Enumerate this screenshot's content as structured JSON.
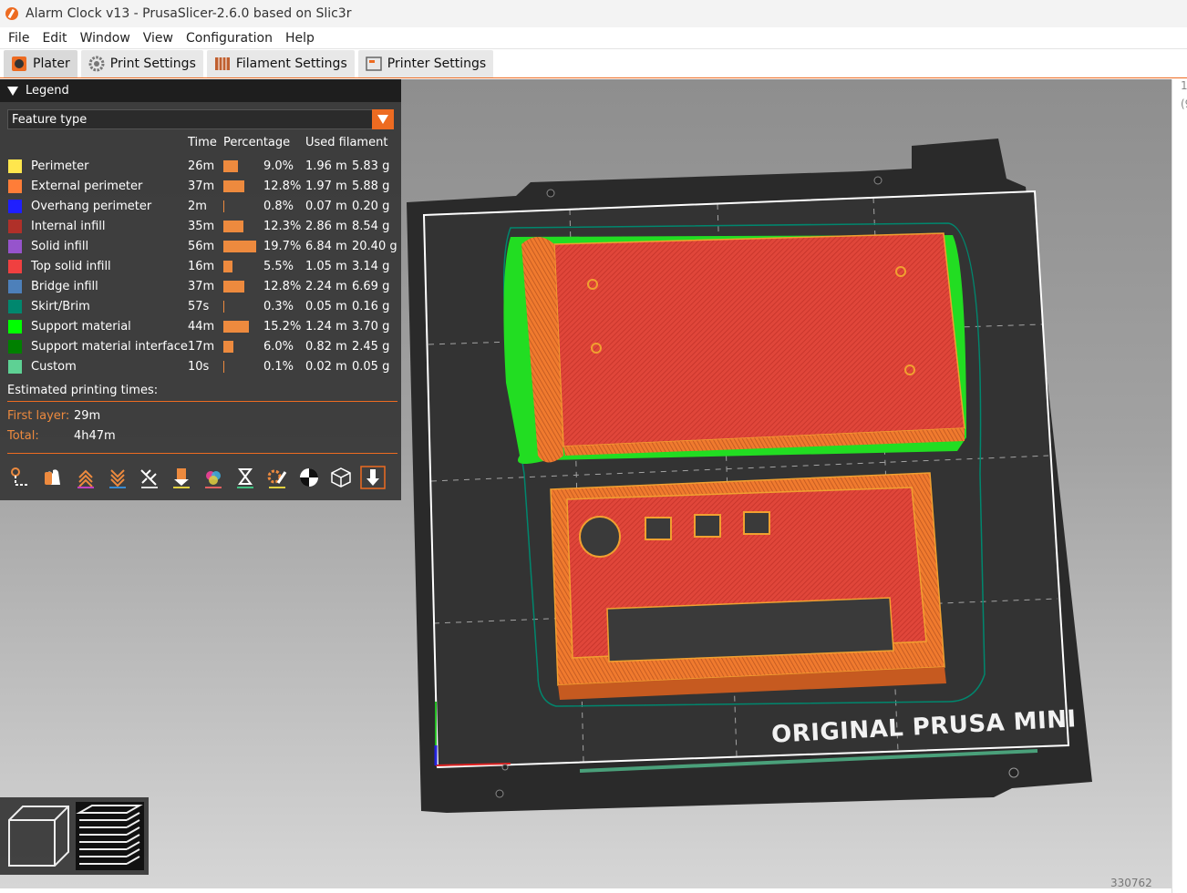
{
  "window": {
    "title": "Alarm Clock v13 - PrusaSlicer-2.6.0 based on Slic3r"
  },
  "menu": [
    "File",
    "Edit",
    "Window",
    "View",
    "Configuration",
    "Help"
  ],
  "tabs": [
    {
      "label": "Plater",
      "icon": "plater-icon",
      "active": true
    },
    {
      "label": "Print Settings",
      "icon": "gear-icon",
      "active": false
    },
    {
      "label": "Filament Settings",
      "icon": "filament-spool-icon",
      "active": false
    },
    {
      "label": "Printer Settings",
      "icon": "printer-icon",
      "active": false
    }
  ],
  "legend": {
    "title": "Legend",
    "view_type": "Feature type",
    "columns": {
      "time": "Time",
      "percentage": "Percentage",
      "used_filament": "Used filament"
    },
    "rows": [
      {
        "name": "Perimeter",
        "color": "#FFE64D",
        "time": "26m",
        "fraction": 0.09,
        "percent": "9.0%",
        "length": "1.96 m",
        "weight": "5.83 g"
      },
      {
        "name": "External perimeter",
        "color": "#FF7D38",
        "time": "37m",
        "fraction": 0.128,
        "percent": "12.8%",
        "length": "1.97 m",
        "weight": "5.88 g"
      },
      {
        "name": "Overhang perimeter",
        "color": "#1F1FFF",
        "time": "2m",
        "fraction": 0.008,
        "percent": "0.8%",
        "length": "0.07 m",
        "weight": "0.20 g"
      },
      {
        "name": "Internal infill",
        "color": "#B03029",
        "time": "35m",
        "fraction": 0.123,
        "percent": "12.3%",
        "length": "2.86 m",
        "weight": "8.54 g"
      },
      {
        "name": "Solid infill",
        "color": "#9654CC",
        "time": "56m",
        "fraction": 0.197,
        "percent": "19.7%",
        "length": "6.84 m",
        "weight": "20.40 g"
      },
      {
        "name": "Top solid infill",
        "color": "#F04040",
        "time": "16m",
        "fraction": 0.055,
        "percent": "5.5%",
        "length": "1.05 m",
        "weight": "3.14 g"
      },
      {
        "name": "Bridge infill",
        "color": "#4D80BA",
        "time": "37m",
        "fraction": 0.128,
        "percent": "12.8%",
        "length": "2.24 m",
        "weight": "6.69 g"
      },
      {
        "name": "Skirt/Brim",
        "color": "#00876E",
        "time": "57s",
        "fraction": 0.003,
        "percent": "0.3%",
        "length": "0.05 m",
        "weight": "0.16 g"
      },
      {
        "name": "Support material",
        "color": "#00FF00",
        "time": "44m",
        "fraction": 0.152,
        "percent": "15.2%",
        "length": "1.24 m",
        "weight": "3.70 g"
      },
      {
        "name": "Support material interface",
        "color": "#008000",
        "time": "17m",
        "fraction": 0.06,
        "percent": "6.0%",
        "length": "0.82 m",
        "weight": "2.45 g"
      },
      {
        "name": "Custom",
        "color": "#5ED194",
        "time": "10s",
        "fraction": 0.001,
        "percent": "0.1%",
        "length": "0.02 m",
        "weight": "0.05 g"
      }
    ],
    "estimated_label": "Estimated printing times:",
    "first_layer_label": "First layer:",
    "first_layer_value": "29m",
    "total_label": "Total:",
    "total_value": "4h47m",
    "toolbar_icons": [
      "travel-icon",
      "wipe-icon",
      "retractions-icon",
      "deretractions-icon",
      "seams-icon",
      "tool-changes-icon",
      "color-changes-icon",
      "pause-prints-icon",
      "custom-gcodes-icon",
      "center-of-gravity-icon",
      "shells-icon",
      "tool-marker-icon"
    ]
  },
  "bed": {
    "label": "ORIGINAL PRUSA MINI"
  },
  "right_strip": {
    "line1": "1",
    "line2": "(9"
  },
  "build_number": "330762",
  "view_buttons": [
    "3d-view-icon",
    "preview-layers-icon"
  ],
  "colors": {
    "accent": "#ED6B21",
    "legend_bg": "#373737"
  }
}
